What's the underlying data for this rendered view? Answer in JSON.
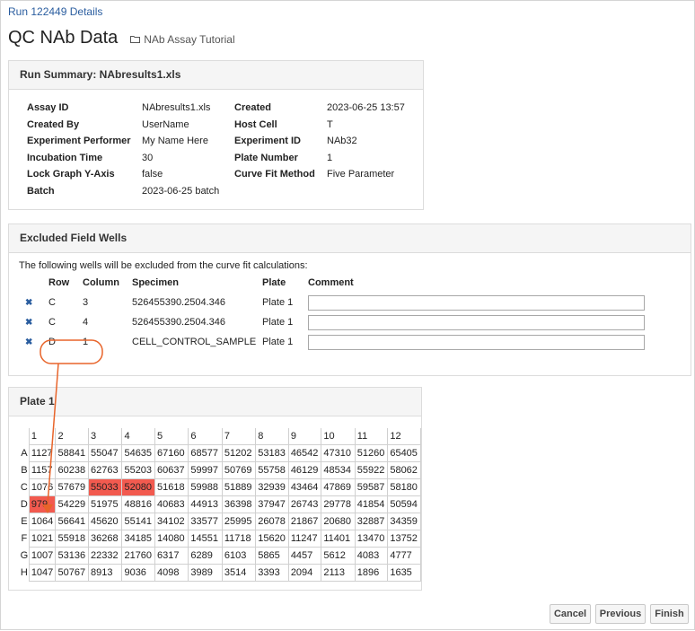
{
  "breadcrumb": "Run 122449 Details",
  "page_title": "QC NAb Data",
  "folder": "NAb Assay Tutorial",
  "run_summary": {
    "heading": "Run Summary: NAbresults1.xls",
    "left": [
      {
        "label": "Assay ID",
        "value": "NAbresults1.xls"
      },
      {
        "label": "Created By",
        "value": "UserName"
      },
      {
        "label": "Experiment Performer",
        "value": "My Name Here"
      },
      {
        "label": "Incubation Time",
        "value": "30"
      },
      {
        "label": "Lock Graph Y-Axis",
        "value": "false"
      },
      {
        "label": "Batch",
        "value": "2023-06-25 batch"
      }
    ],
    "right": [
      {
        "label": "Created",
        "value": "2023-06-25 13:57"
      },
      {
        "label": "Host Cell",
        "value": "T"
      },
      {
        "label": "Experiment ID",
        "value": "NAb32"
      },
      {
        "label": "Plate Number",
        "value": "1"
      },
      {
        "label": "Curve Fit Method",
        "value": "Five Parameter"
      }
    ]
  },
  "excluded": {
    "heading": "Excluded Field Wells",
    "intro": "The following wells will be excluded from the curve fit calculations:",
    "columns": [
      "Row",
      "Column",
      "Specimen",
      "Plate",
      "Comment"
    ],
    "rows": [
      {
        "row": "C",
        "column": "3",
        "specimen": "526455390.2504.346",
        "plate": "Plate 1",
        "comment": ""
      },
      {
        "row": "C",
        "column": "4",
        "specimen": "526455390.2504.346",
        "plate": "Plate 1",
        "comment": ""
      },
      {
        "row": "D",
        "column": "1",
        "specimen": "CELL_CONTROL_SAMPLE",
        "plate": "Plate 1",
        "comment": ""
      }
    ]
  },
  "plate": {
    "heading": "Plate 1",
    "col_headers": [
      "1",
      "2",
      "3",
      "4",
      "5",
      "6",
      "7",
      "8",
      "9",
      "10",
      "11",
      "12"
    ],
    "row_labels": [
      "A",
      "B",
      "C",
      "D",
      "E",
      "F",
      "G",
      "H"
    ],
    "cells": [
      [
        "1127",
        "58841",
        "55047",
        "54635",
        "67160",
        "68577",
        "51202",
        "53183",
        "46542",
        "47310",
        "51260",
        "65405"
      ],
      [
        "1157",
        "60238",
        "62763",
        "55203",
        "60637",
        "59997",
        "50769",
        "55758",
        "46129",
        "48534",
        "55922",
        "58062"
      ],
      [
        "1076",
        "57679",
        "55033",
        "52080",
        "51618",
        "59988",
        "51889",
        "32939",
        "43464",
        "47869",
        "59587",
        "58180"
      ],
      [
        "979",
        "54229",
        "51975",
        "48816",
        "40683",
        "44913",
        "36398",
        "37947",
        "26743",
        "29778",
        "41854",
        "50594"
      ],
      [
        "1064",
        "56641",
        "45620",
        "55141",
        "34102",
        "33577",
        "25995",
        "26078",
        "21867",
        "20680",
        "32887",
        "34359"
      ],
      [
        "1021",
        "55918",
        "36268",
        "34185",
        "14080",
        "14551",
        "11718",
        "15620",
        "11247",
        "11401",
        "13470",
        "13752"
      ],
      [
        "1007",
        "53136",
        "22332",
        "21760",
        "6317",
        "6289",
        "6103",
        "5865",
        "4457",
        "5612",
        "4083",
        "4777"
      ],
      [
        "1047",
        "50767",
        "8913",
        "9036",
        "4098",
        "3989",
        "3514",
        "3393",
        "2094",
        "2113",
        "1896",
        "1635"
      ]
    ],
    "excluded_cells": [
      [
        2,
        2
      ],
      [
        2,
        3
      ],
      [
        3,
        0
      ]
    ]
  },
  "buttons": {
    "cancel": "Cancel",
    "previous": "Previous",
    "finish": "Finish"
  },
  "colors": {
    "link": "#2a5d9f",
    "excluded_well": "#f25a4f",
    "annotation": "#e8642a"
  }
}
